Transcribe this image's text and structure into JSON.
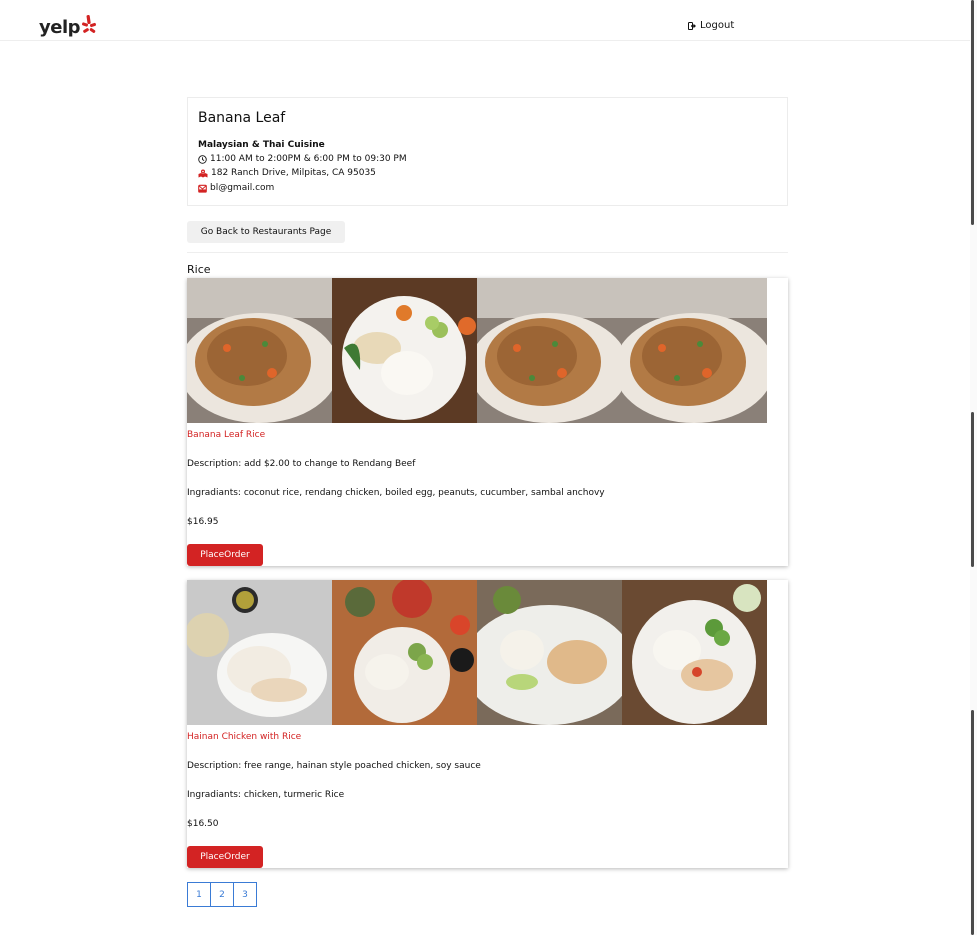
{
  "header": {
    "logo_text": "yelp",
    "logout_label": "Logout"
  },
  "restaurant": {
    "name": "Banana Leaf",
    "cuisine": "Malaysian & Thai Cuisine",
    "hours": "11:00 AM to 2:00PM & 6:00 PM to 09:30 PM",
    "address": "182 Ranch Drive, Milpitas, CA 95035",
    "email": "bl@gmail.com"
  },
  "back_button_label": "Go Back to Restaurants Page",
  "category": "Rice",
  "dishes": [
    {
      "name": "Banana Leaf Rice",
      "description": "Description: add $2.00 to change to Rendang Beef",
      "ingredients": "Ingradiants: coconut rice, rendang chicken, boiled egg, peanuts, cucumber, sambal anchovy",
      "price": "$16.95",
      "order_label": "PlaceOrder"
    },
    {
      "name": "Hainan Chicken with Rice",
      "description": "Description: free range, hainan style poached chicken, soy sauce",
      "ingredients": "Ingradiants: chicken, turmeric Rice",
      "price": "$16.50",
      "order_label": "PlaceOrder"
    }
  ],
  "pagination": [
    "1",
    "2",
    "3"
  ],
  "colors": {
    "brand_red": "#d32323",
    "link_blue": "#3a7bd5"
  }
}
